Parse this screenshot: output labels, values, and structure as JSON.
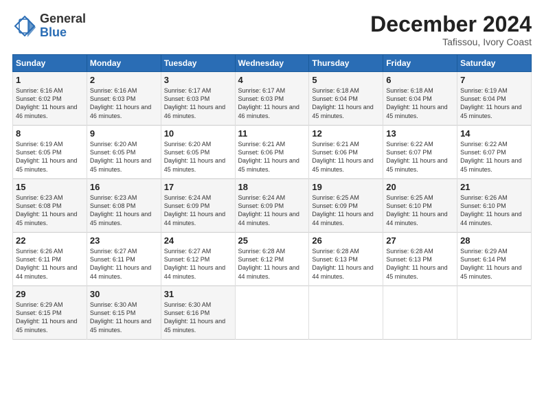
{
  "logo": {
    "general": "General",
    "blue": "Blue"
  },
  "title": "December 2024",
  "subtitle": "Tafissou, Ivory Coast",
  "days_header": [
    "Sunday",
    "Monday",
    "Tuesday",
    "Wednesday",
    "Thursday",
    "Friday",
    "Saturday"
  ],
  "weeks": [
    [
      {
        "day": "1",
        "sunrise": "6:16 AM",
        "sunset": "6:02 PM",
        "daylight": "11 hours and 46 minutes."
      },
      {
        "day": "2",
        "sunrise": "6:16 AM",
        "sunset": "6:03 PM",
        "daylight": "11 hours and 46 minutes."
      },
      {
        "day": "3",
        "sunrise": "6:17 AM",
        "sunset": "6:03 PM",
        "daylight": "11 hours and 46 minutes."
      },
      {
        "day": "4",
        "sunrise": "6:17 AM",
        "sunset": "6:03 PM",
        "daylight": "11 hours and 46 minutes."
      },
      {
        "day": "5",
        "sunrise": "6:18 AM",
        "sunset": "6:04 PM",
        "daylight": "11 hours and 45 minutes."
      },
      {
        "day": "6",
        "sunrise": "6:18 AM",
        "sunset": "6:04 PM",
        "daylight": "11 hours and 45 minutes."
      },
      {
        "day": "7",
        "sunrise": "6:19 AM",
        "sunset": "6:04 PM",
        "daylight": "11 hours and 45 minutes."
      }
    ],
    [
      {
        "day": "8",
        "sunrise": "6:19 AM",
        "sunset": "6:05 PM",
        "daylight": "11 hours and 45 minutes."
      },
      {
        "day": "9",
        "sunrise": "6:20 AM",
        "sunset": "6:05 PM",
        "daylight": "11 hours and 45 minutes."
      },
      {
        "day": "10",
        "sunrise": "6:20 AM",
        "sunset": "6:05 PM",
        "daylight": "11 hours and 45 minutes."
      },
      {
        "day": "11",
        "sunrise": "6:21 AM",
        "sunset": "6:06 PM",
        "daylight": "11 hours and 45 minutes."
      },
      {
        "day": "12",
        "sunrise": "6:21 AM",
        "sunset": "6:06 PM",
        "daylight": "11 hours and 45 minutes."
      },
      {
        "day": "13",
        "sunrise": "6:22 AM",
        "sunset": "6:07 PM",
        "daylight": "11 hours and 45 minutes."
      },
      {
        "day": "14",
        "sunrise": "6:22 AM",
        "sunset": "6:07 PM",
        "daylight": "11 hours and 45 minutes."
      }
    ],
    [
      {
        "day": "15",
        "sunrise": "6:23 AM",
        "sunset": "6:08 PM",
        "daylight": "11 hours and 45 minutes."
      },
      {
        "day": "16",
        "sunrise": "6:23 AM",
        "sunset": "6:08 PM",
        "daylight": "11 hours and 45 minutes."
      },
      {
        "day": "17",
        "sunrise": "6:24 AM",
        "sunset": "6:09 PM",
        "daylight": "11 hours and 44 minutes."
      },
      {
        "day": "18",
        "sunrise": "6:24 AM",
        "sunset": "6:09 PM",
        "daylight": "11 hours and 44 minutes."
      },
      {
        "day": "19",
        "sunrise": "6:25 AM",
        "sunset": "6:09 PM",
        "daylight": "11 hours and 44 minutes."
      },
      {
        "day": "20",
        "sunrise": "6:25 AM",
        "sunset": "6:10 PM",
        "daylight": "11 hours and 44 minutes."
      },
      {
        "day": "21",
        "sunrise": "6:26 AM",
        "sunset": "6:10 PM",
        "daylight": "11 hours and 44 minutes."
      }
    ],
    [
      {
        "day": "22",
        "sunrise": "6:26 AM",
        "sunset": "6:11 PM",
        "daylight": "11 hours and 44 minutes."
      },
      {
        "day": "23",
        "sunrise": "6:27 AM",
        "sunset": "6:11 PM",
        "daylight": "11 hours and 44 minutes."
      },
      {
        "day": "24",
        "sunrise": "6:27 AM",
        "sunset": "6:12 PM",
        "daylight": "11 hours and 44 minutes."
      },
      {
        "day": "25",
        "sunrise": "6:28 AM",
        "sunset": "6:12 PM",
        "daylight": "11 hours and 44 minutes."
      },
      {
        "day": "26",
        "sunrise": "6:28 AM",
        "sunset": "6:13 PM",
        "daylight": "11 hours and 44 minutes."
      },
      {
        "day": "27",
        "sunrise": "6:28 AM",
        "sunset": "6:13 PM",
        "daylight": "11 hours and 45 minutes."
      },
      {
        "day": "28",
        "sunrise": "6:29 AM",
        "sunset": "6:14 PM",
        "daylight": "11 hours and 45 minutes."
      }
    ],
    [
      {
        "day": "29",
        "sunrise": "6:29 AM",
        "sunset": "6:15 PM",
        "daylight": "11 hours and 45 minutes."
      },
      {
        "day": "30",
        "sunrise": "6:30 AM",
        "sunset": "6:15 PM",
        "daylight": "11 hours and 45 minutes."
      },
      {
        "day": "31",
        "sunrise": "6:30 AM",
        "sunset": "6:16 PM",
        "daylight": "11 hours and 45 minutes."
      },
      null,
      null,
      null,
      null
    ]
  ]
}
